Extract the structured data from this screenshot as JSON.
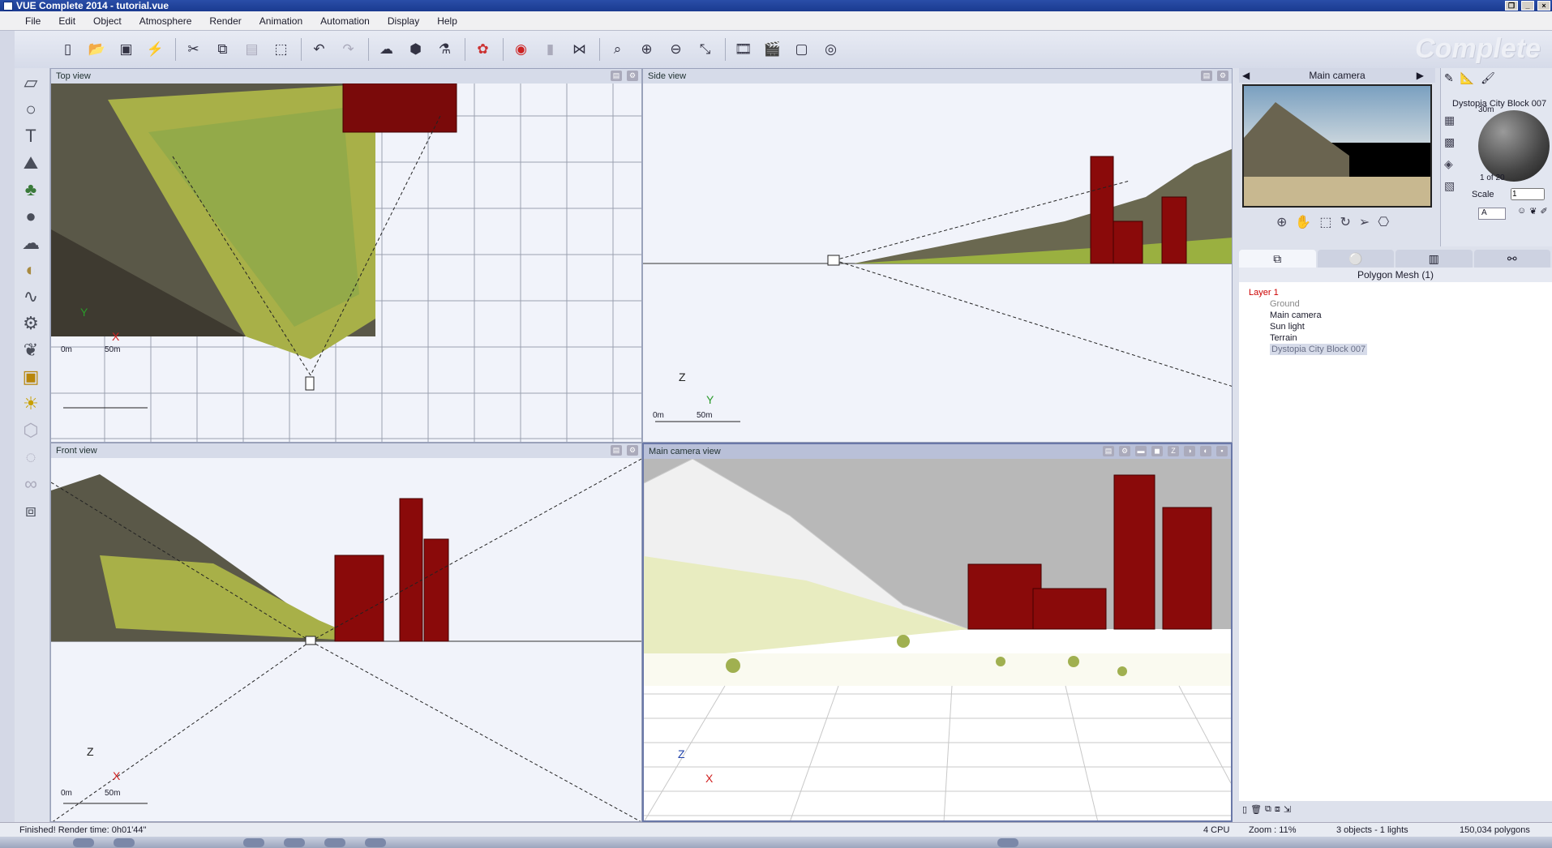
{
  "window": {
    "title": "VUE Complete 2014 - tutorial.vue"
  },
  "menu": [
    "File",
    "Edit",
    "Object",
    "Atmosphere",
    "Render",
    "Animation",
    "Automation",
    "Display",
    "Help"
  ],
  "brand": "Complete",
  "toolbar_icons": [
    "new-icon",
    "open-icon",
    "save-icon",
    "quick-icon",
    "cut-icon",
    "copy-icon",
    "paste-icon",
    "duplicate-icon",
    "undo-icon",
    "redo-icon",
    "atmosphere-icon",
    "objects-icon",
    "material-icon",
    "color-icon",
    "render-icon",
    "camera-icon",
    "mirror-icon",
    "zoom-frame-icon",
    "zoom-in-icon",
    "zoom-out-icon",
    "resize-icon",
    "film-icon",
    "clapper-icon",
    "frame-icon",
    "render-camera-icon"
  ],
  "left_tools": [
    "terrain-plane-icon",
    "sphere-icon",
    "text-icon",
    "mountain-icon",
    "tree-icon",
    "rock-icon",
    "cloud-icon",
    "planet-icon",
    "spline-icon",
    "object-library-icon",
    "plant-icon",
    "cube-icon",
    "light-icon",
    "boolean-icon",
    "metablob-icon",
    "link-icon",
    "metrics-icon"
  ],
  "views": {
    "top": {
      "title": "Top view",
      "scale_start": "0m",
      "scale_end": "50m",
      "axis_h": "X",
      "axis_v": "Y"
    },
    "side": {
      "title": "Side view",
      "scale_start": "0m",
      "scale_end": "50m",
      "axis_h": "Y",
      "axis_v": "Z"
    },
    "front": {
      "title": "Front view",
      "scale_start": "0m",
      "scale_end": "50m",
      "axis_h": "X",
      "axis_v": "Z"
    },
    "camera": {
      "title": "Main camera view",
      "axis_h": "X",
      "axis_v": "Z"
    }
  },
  "camera_panel": {
    "title": "Main camera",
    "material_name": "Dystopia City Block 007",
    "size_label": "30m",
    "count": "1 of 20",
    "scale_label": "Scale",
    "scale_value": "1",
    "layer_value": "A"
  },
  "object_tabs": [
    "objects",
    "materials",
    "library",
    "links"
  ],
  "polygon_mesh": "Polygon Mesh (1)",
  "tree": [
    {
      "label": "Layer 1",
      "color": "#cc0000"
    },
    {
      "label": "Ground",
      "color": "#888888"
    },
    {
      "label": "Main camera",
      "color": "#222222"
    },
    {
      "label": "Sun light",
      "color": "#222222"
    },
    {
      "label": "Terrain",
      "color": "#222222"
    },
    {
      "label": "Dystopia City Block 007",
      "color": "#6a7088"
    }
  ],
  "status": {
    "message": "Finished! Render time: 0h01'44\"",
    "cpu": "4 CPU",
    "zoom": "Zoom : 11%",
    "objects": "3 objects - 1 lights",
    "polygons": "150,034 polygons"
  }
}
